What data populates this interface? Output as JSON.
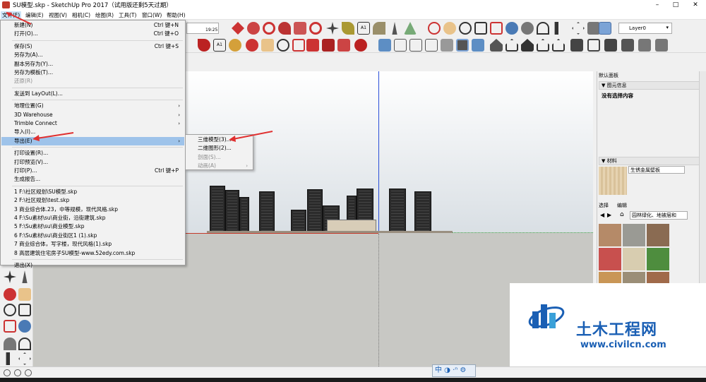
{
  "window": {
    "title": "SU模型.skp - SketchUp Pro 2017（试用版还剩5天过期）",
    "minimize": "–",
    "maximize": "□",
    "close": "✕"
  },
  "menubar": [
    "文件(F)",
    "编辑(E)",
    "视图(V)",
    "相机(C)",
    "绘图(R)",
    "工具(T)",
    "窗口(W)",
    "帮助(H)"
  ],
  "file_menu": [
    {
      "label": "新建(N)",
      "shortcut": "Ctrl 键+N"
    },
    {
      "label": "打开(O)...",
      "shortcut": "Ctrl 键+O"
    },
    {
      "sep": true
    },
    {
      "label": "保存(S)",
      "shortcut": "Ctrl 键+S"
    },
    {
      "label": "另存为(A)..."
    },
    {
      "label": "副本另存为(Y)..."
    },
    {
      "label": "另存为模板(T)..."
    },
    {
      "label": "还原(R)",
      "disabled": true
    },
    {
      "sep": true
    },
    {
      "label": "发送到 LayOut(L)..."
    },
    {
      "sep": true
    },
    {
      "label": "地理位置(G)",
      "arrow": "›"
    },
    {
      "label": "3D Warehouse",
      "arrow": "›"
    },
    {
      "label": "Trimble Connect",
      "arrow": "›"
    },
    {
      "label": "导入(I)..."
    },
    {
      "label": "导出(E)",
      "arrow": "›",
      "highlighted": true
    },
    {
      "sep": true
    },
    {
      "label": "打印设置(R)..."
    },
    {
      "label": "打印预览(V)..."
    },
    {
      "label": "打印(P)...",
      "shortcut": "Ctrl 键+P"
    },
    {
      "label": "生成报告..."
    },
    {
      "sep": true
    },
    {
      "label": "1 F:\\社区规划\\SU模型.skp"
    },
    {
      "label": "2 F:\\社区规划\\test.skp"
    },
    {
      "label": "3 商业综合体.23，中等规模，现代风格.skp"
    },
    {
      "label": "4 F:\\Su素材\\su\\商业街，沿街建筑.skp"
    },
    {
      "label": "5 F:\\Su素材\\su\\商业模型.skp"
    },
    {
      "label": "6 F:\\Su素材\\su\\商业街区1 (1).skp"
    },
    {
      "label": "7 商业综合体，写字楼，现代风格(1).skp"
    },
    {
      "label": "8 高层建筑住宅房子SU模型-www.52edy.com.skp"
    },
    {
      "sep": true
    },
    {
      "label": "退出(X)"
    }
  ],
  "export_submenu": [
    {
      "label": "三维模型(3)..."
    },
    {
      "label": "二维图形(2)..."
    },
    {
      "label": "剖面(S)...",
      "disabled": true
    },
    {
      "label": "动画(A)",
      "disabled": true,
      "arrow": "›"
    }
  ],
  "time_slider": {
    "time": "19:25"
  },
  "layer": {
    "value": "Layer0"
  },
  "panel": {
    "title": "默认面板",
    "entity_info": {
      "header": "图元信息",
      "value": "没有选择内容"
    },
    "materials": {
      "header": "材料",
      "material_name": "生锈金属壁板",
      "tab_select": "选择",
      "tab_edit": "编辑",
      "collection": "园林绿化、地被层和"
    }
  },
  "status": {
    "view_tools": "中 ◑ ·ⁿ ⚙"
  },
  "watermark": {
    "brand": "土木工程网",
    "url": "www.civilcn.com"
  },
  "colors": {
    "menu_highlight": "#9ec3ea",
    "annotation_arrow": "#e03030",
    "axis_blue": "#2b4fd8",
    "axis_red": "#c43a2a",
    "axis_green": "#3a9a3a",
    "watermark_blue": "#1a5fb4"
  },
  "icons": [
    "app-icon",
    "rotate-icon",
    "orbit-icon",
    "zoom-icon",
    "zoom-extents-icon",
    "walk-icon",
    "look-around-icon",
    "section-plane-icon",
    "house-icon",
    "pencil-icon",
    "paint-bucket-icon",
    "home-icon"
  ]
}
